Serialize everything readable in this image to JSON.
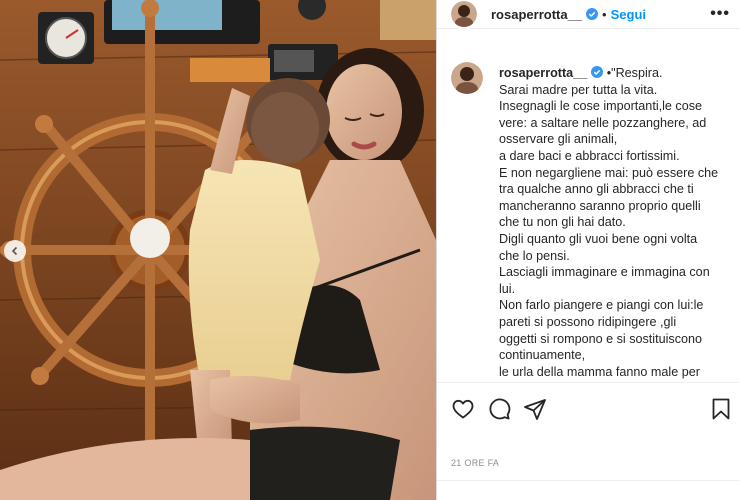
{
  "header": {
    "username": "rosaperrotta__",
    "separator": "•",
    "follow_label": "Segui",
    "more_label": "•••"
  },
  "caption": {
    "username": "rosaperrotta__",
    "lines": [
      "•\"Respira.",
      "Sarai madre per tutta la vita.",
      "Insegnagli le cose importanti,le cose",
      "vere: a saltare nelle pozzanghere, ad",
      "osservare gli animali,",
      "a dare baci e abbracci fortissimi.",
      "E non negargliene mai: può essere che",
      "tra qualche anno gli abbracci che ti",
      "mancheranno saranno proprio quelli",
      "che tu non gli hai dato.",
      "Digli quanto gli vuoi bene ogni volta",
      "che lo pensi.",
      "Lasciagli immaginare e immagina con",
      "lui.",
      "Non farlo piangere e piangi con lui:le",
      "pareti si possono ridipingere ,gli",
      "oggetti si rompono e si sostituiscono",
      "continuamente,",
      "le urla della mamma fanno male per"
    ]
  },
  "timestamp": "21 ORE FA",
  "icons": {
    "like": "heart-icon",
    "comment": "comment-icon",
    "share": "share-icon",
    "save": "bookmark-icon",
    "verified": "verified-badge-icon",
    "prev": "chevron-left-icon"
  },
  "colors": {
    "accent": "#0095f6",
    "text": "#262626",
    "muted": "#8e8e8e"
  }
}
